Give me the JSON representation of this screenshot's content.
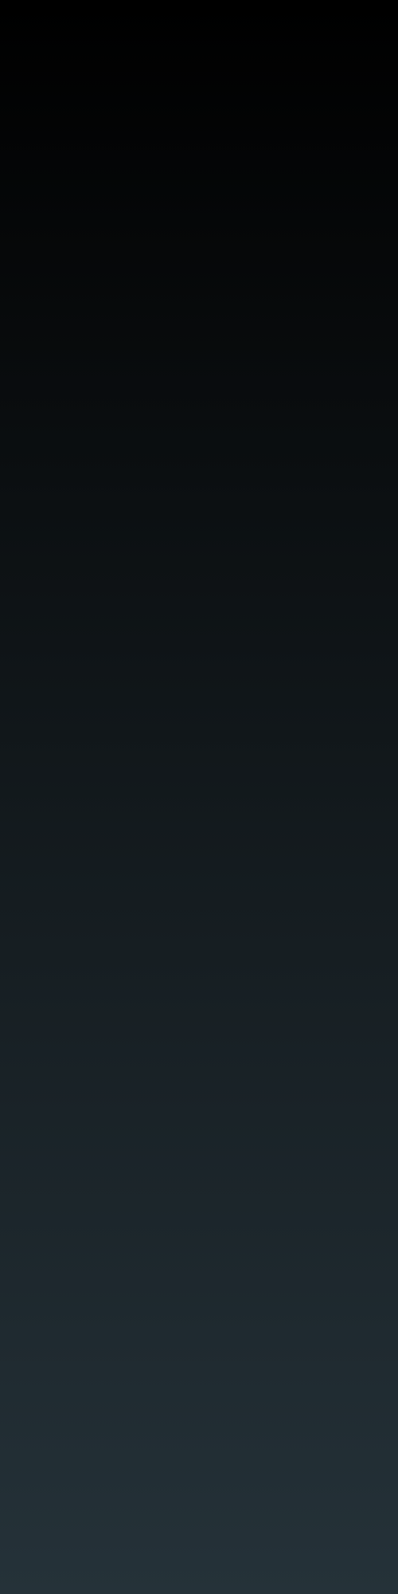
{
  "background": {
    "top_color": "#000000",
    "bottom_color": "#253239"
  }
}
